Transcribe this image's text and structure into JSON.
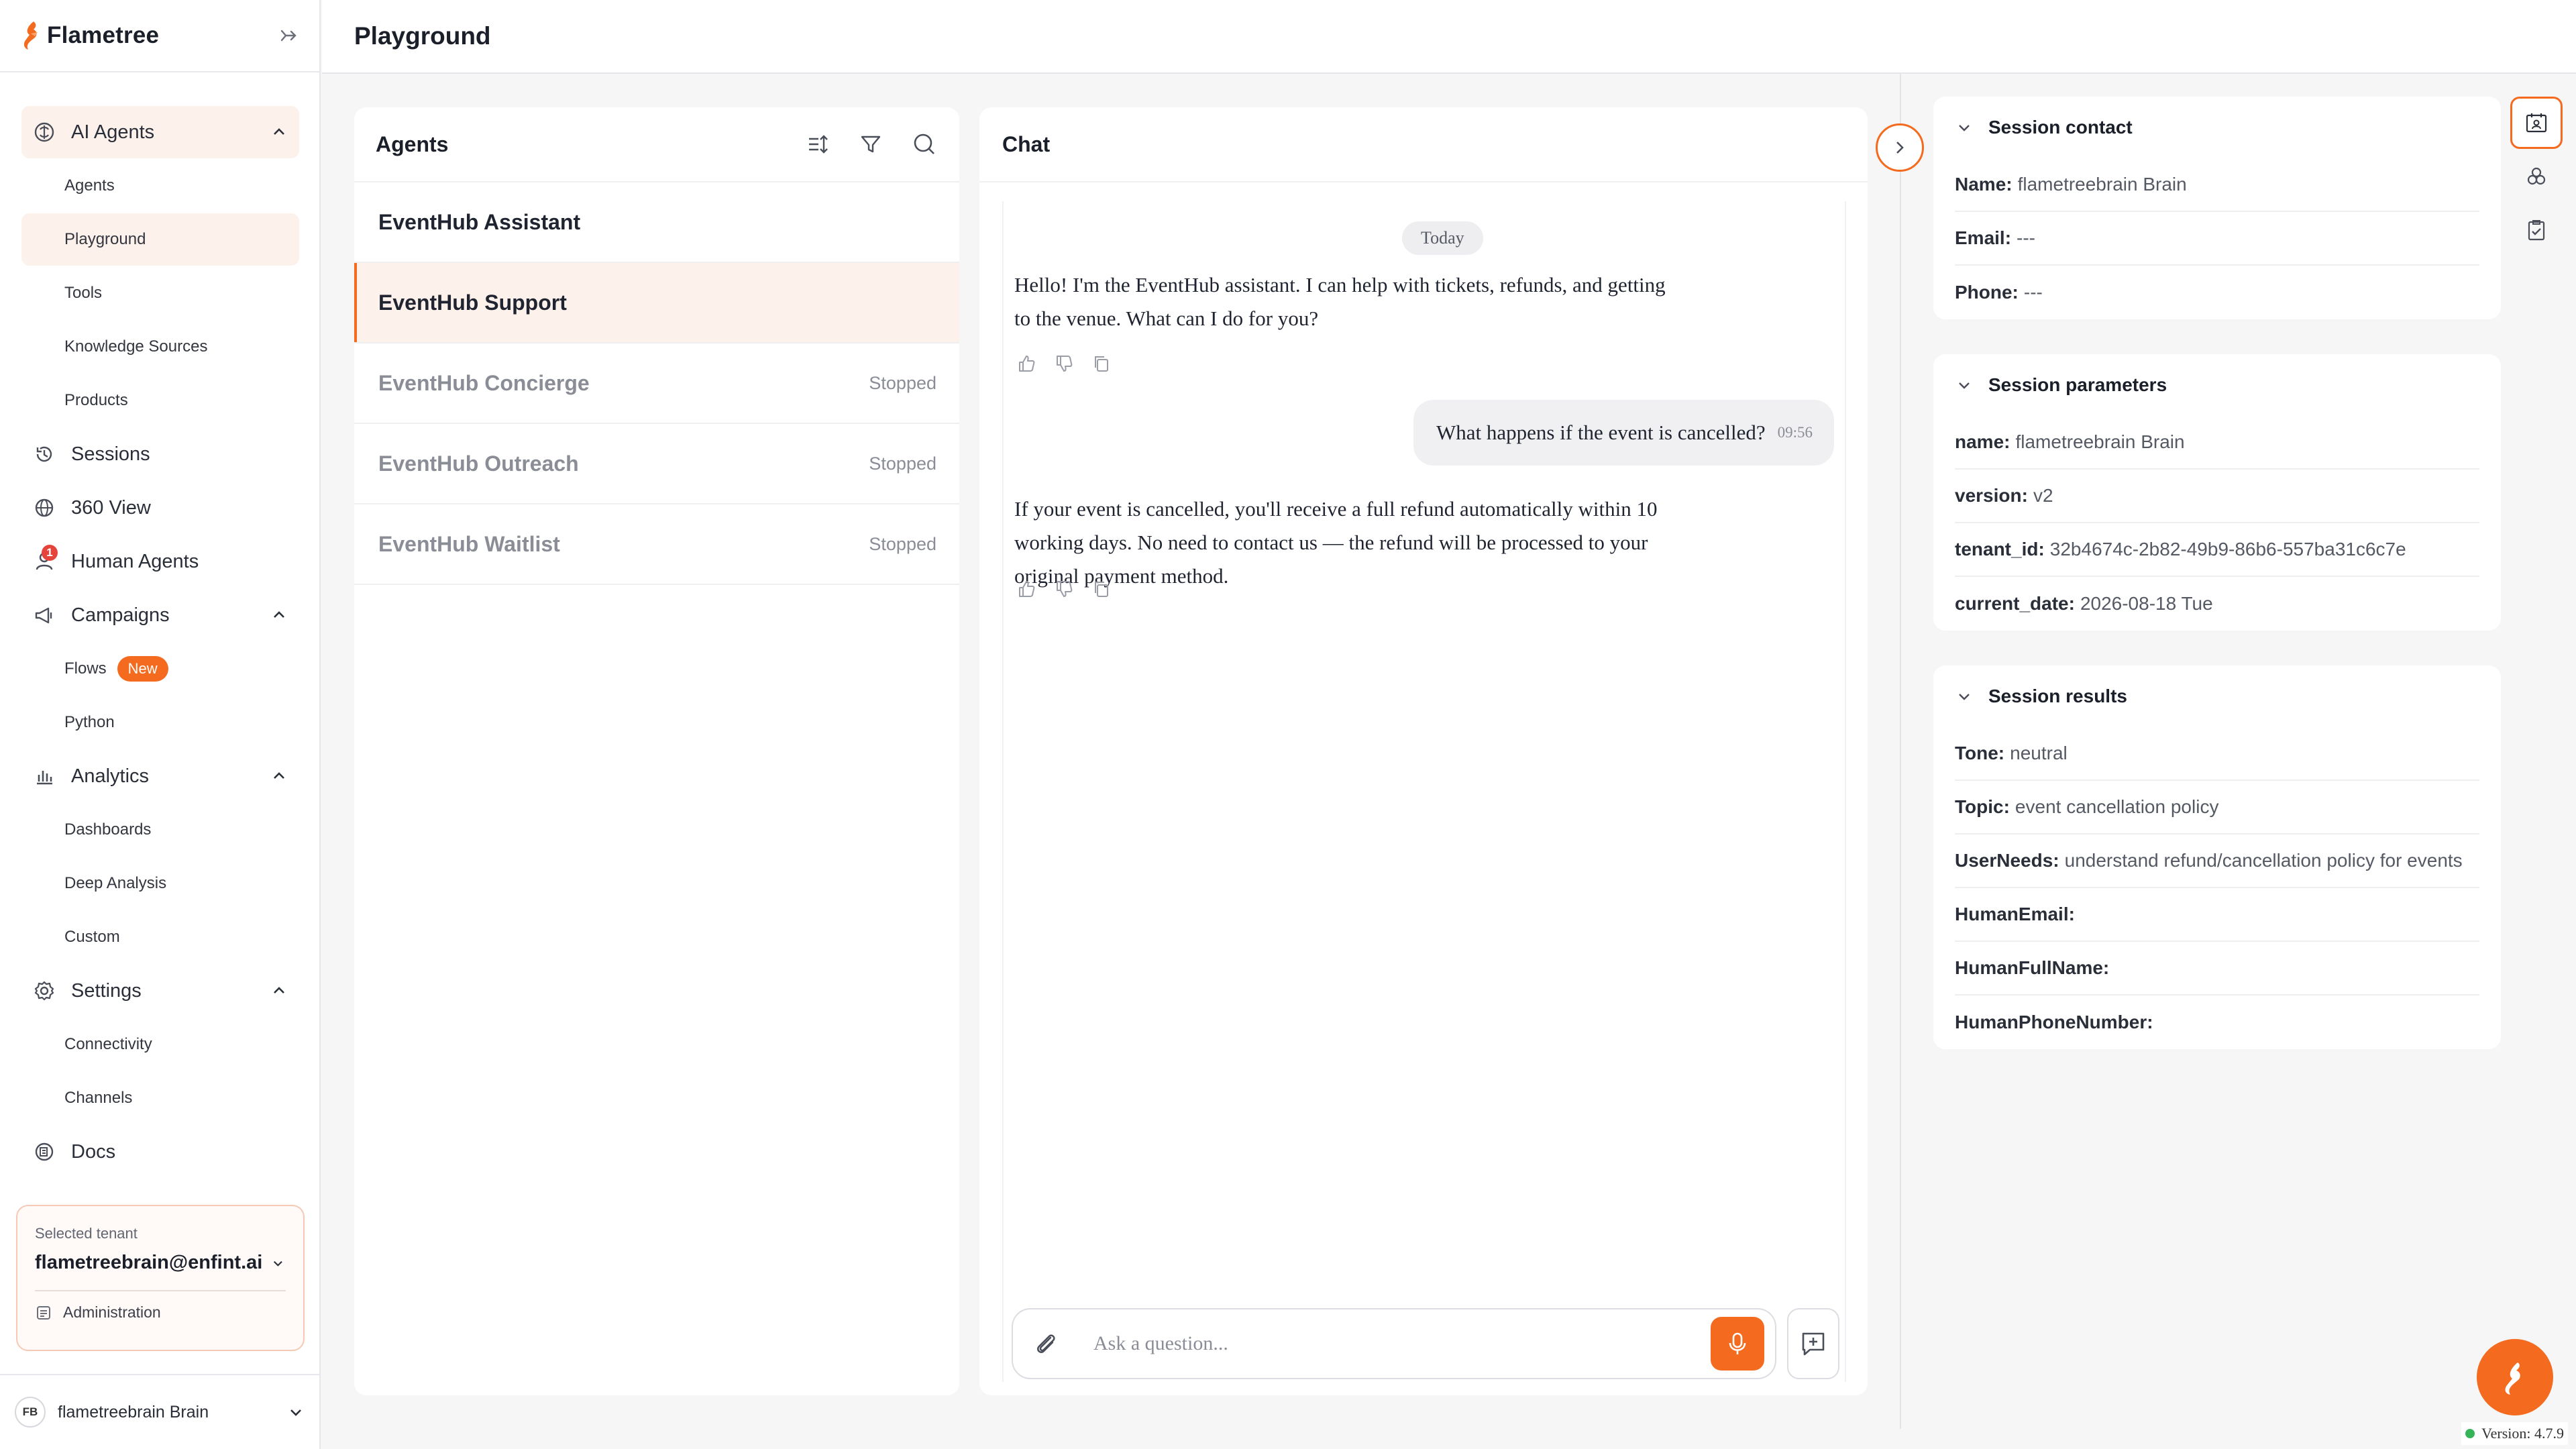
{
  "app": {
    "name": "Flametree",
    "version_label": "Version: 4.7.9"
  },
  "colors": {
    "accent": "#f46b1f",
    "accent_light": "#fdf1ec",
    "status_ok": "#35b45a"
  },
  "header": {
    "title": "Playground"
  },
  "sidebar": {
    "sections": [
      {
        "label": "AI Agents",
        "icon": "brain-icon",
        "expanded": true,
        "items": [
          "Agents",
          "Playground",
          "Tools",
          "Knowledge Sources",
          "Products"
        ]
      },
      {
        "label": "Sessions",
        "icon": "history-icon"
      },
      {
        "label": "360 View",
        "icon": "globe-icon"
      },
      {
        "label": "Human Agents",
        "icon": "person-icon",
        "badge": "1"
      },
      {
        "label": "Campaigns",
        "icon": "megaphone-icon",
        "expanded": true,
        "items": [
          "Flows",
          "Python"
        ],
        "flows_badge": "New"
      },
      {
        "label": "Analytics",
        "icon": "chart-icon",
        "expanded": true,
        "items": [
          "Dashboards",
          "Deep Analysis",
          "Custom"
        ]
      },
      {
        "label": "Settings",
        "icon": "gear-icon",
        "expanded": true,
        "items": [
          "Connectivity",
          "Channels"
        ]
      },
      {
        "label": "Docs",
        "icon": "docs-icon"
      }
    ],
    "tenant": {
      "label": "Selected tenant",
      "value": "flametreebrain@enfint.ai",
      "admin_label": "Administration"
    },
    "user": {
      "initials": "FB",
      "name": "flametreebrain Brain"
    }
  },
  "agents_panel": {
    "title": "Agents",
    "agents": [
      {
        "name": "EventHub Assistant",
        "status": ""
      },
      {
        "name": "EventHub Support",
        "status": ""
      },
      {
        "name": "EventHub Concierge",
        "status": "Stopped"
      },
      {
        "name": "EventHub Outreach",
        "status": "Stopped"
      },
      {
        "name": "EventHub Waitlist",
        "status": "Stopped"
      }
    ]
  },
  "chat": {
    "title": "Chat",
    "date_label": "Today",
    "messages": [
      {
        "role": "bot",
        "lines": [
          "Hello! I'm the EventHub assistant. I can help with tickets, refunds, and getting",
          "to the venue. What can I do for you?"
        ]
      },
      {
        "role": "user",
        "text": "What happens if the event is cancelled?",
        "time": "09:56"
      },
      {
        "role": "bot",
        "lines": [
          "If your event is cancelled, you'll receive a full refund automatically within 10",
          "working days. No need to contact us — the refund will be processed to your",
          "original payment method."
        ]
      }
    ],
    "input_placeholder": "Ask a question..."
  },
  "session": {
    "contact": {
      "title": "Session contact",
      "fields": [
        {
          "key": "Name:",
          "value": "flametreebrain Brain"
        },
        {
          "key": "Email:",
          "value": "---"
        },
        {
          "key": "Phone:",
          "value": "---"
        }
      ]
    },
    "parameters": {
      "title": "Session parameters",
      "fields": [
        {
          "key": "name:",
          "value": "flametreebrain Brain"
        },
        {
          "key": "version:",
          "value": "v2"
        },
        {
          "key": "tenant_id:",
          "value": "32b4674c-2b82-49b9-86b6-557ba31c6c7e"
        },
        {
          "key": "current_date:",
          "value": "2026-08-18 Tue"
        }
      ]
    },
    "results": {
      "title": "Session results",
      "fields": [
        {
          "key": "Tone:",
          "value": "neutral"
        },
        {
          "key": "Topic:",
          "value": "event cancellation policy"
        },
        {
          "key": "UserNeeds:",
          "value": "understand refund/cancellation policy for events"
        },
        {
          "key": "HumanEmail:",
          "value": ""
        },
        {
          "key": "HumanFullName:",
          "value": ""
        },
        {
          "key": "HumanPhoneNumber:",
          "value": ""
        }
      ]
    }
  }
}
